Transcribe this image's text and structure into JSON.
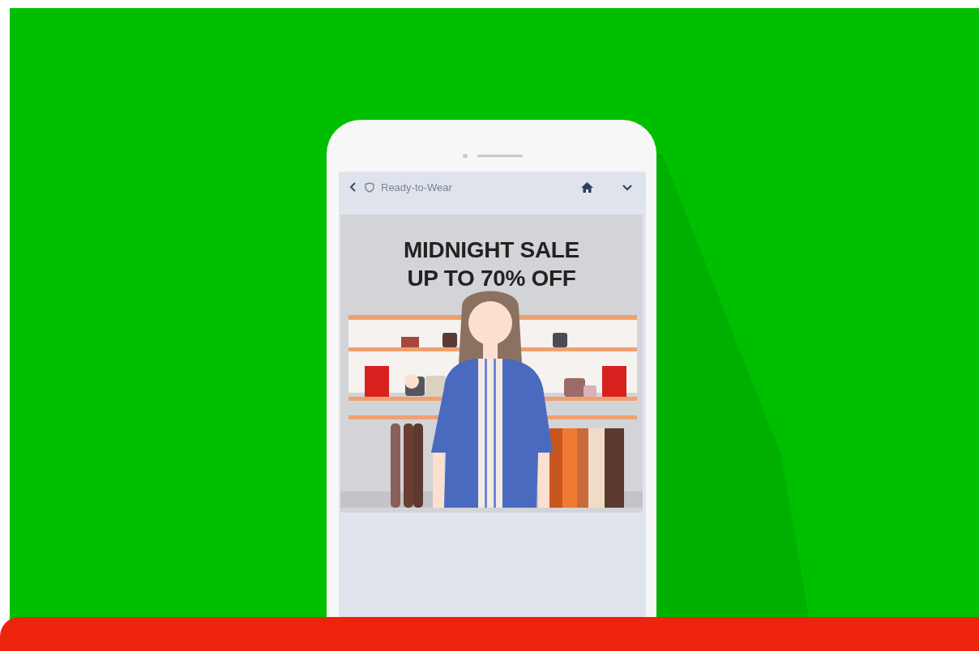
{
  "app_header": {
    "title": "Ready-to-Wear"
  },
  "banner": {
    "headline": [
      "MIDNIGHT SALE",
      "UP TO 70% OFF"
    ]
  }
}
